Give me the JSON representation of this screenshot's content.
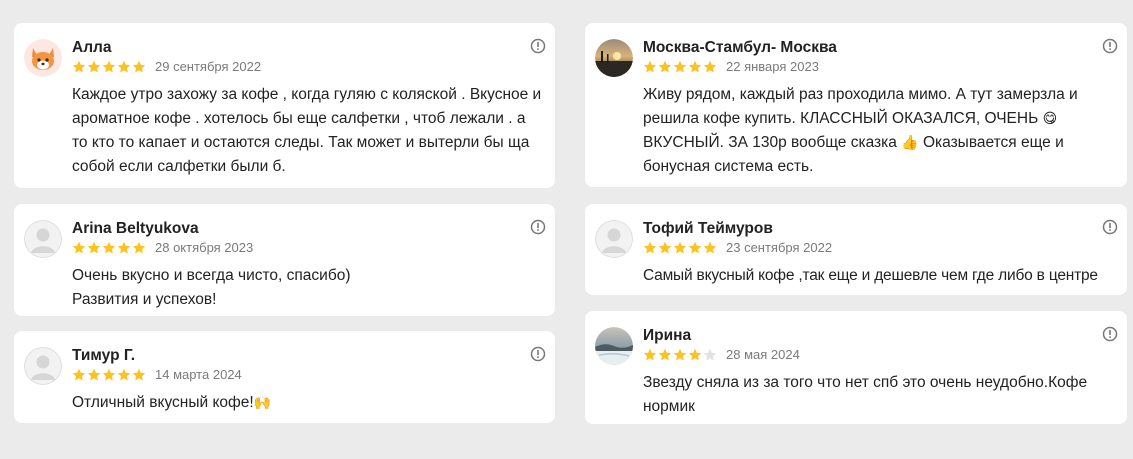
{
  "colors": {
    "background": "#ebebeb",
    "card": "#ffffff",
    "star_filled": "#fcc320",
    "star_empty": "#e2e2e2",
    "date": "#7a7a7a",
    "text": "#222222"
  },
  "reviews": [
    {
      "author": "Алла",
      "avatar": "fox-emoji-avatar",
      "rating": 5,
      "date": "29 сентября 2022",
      "text": "Каждое утро захожу за кофе , когда гуляю с коляской . Вкусное и ароматное кофе . хотелось бы еще салфетки , чтоб лежали . а то кто то капает и остаются следы. Так может и вытерли бы ща собой если салфетки были б."
    },
    {
      "author": "Arina Beltyukova",
      "avatar": "default-user-avatar",
      "rating": 5,
      "date": "28 октября 2023",
      "text": "Очень вкусно и всегда чисто, спасибо) Развития и успехов!"
    },
    {
      "author": "Тимур Г.",
      "avatar": "default-user-avatar",
      "rating": 5,
      "date": "14 марта 2024",
      "text": "Отличный вкусный кофе!",
      "emoji": "🙌"
    },
    {
      "author": "Москва-Стамбул- Москва",
      "avatar": "sunset-photo-avatar",
      "rating": 5,
      "date": "22 января 2023",
      "text_parts": [
        "Живу рядом, каждый раз проходила мимо. А тут замерзла и решила кофе купить. КЛАССНЫЙ ОКАЗАЛСЯ, ОЧЕНЬ ",
        "😋",
        " ВКУСНЫЙ. ЗА 130р вообще сказка ",
        "👍",
        " Оказывается еще и бонусная система есть."
      ]
    },
    {
      "author": "Тофий Теймуров",
      "avatar": "default-user-avatar",
      "rating": 5,
      "date": "23 сентября 2022",
      "text": "Самый вкусный кофе ,так еще и дешевле чем где либо в центре"
    },
    {
      "author": "Ирина",
      "avatar": "winter-landscape-photo-avatar",
      "rating": 4,
      "date": "28 мая 2024",
      "text": "Звезду сняла из за того что нет спб это очень неудобно.Кофе нормик"
    }
  ]
}
